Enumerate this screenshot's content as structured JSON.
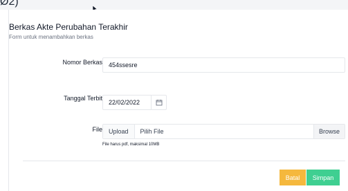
{
  "header": {
    "partial_text": "Ø2)"
  },
  "card": {
    "title": "Berkas Akte Perubahan Terakhir",
    "subtitle": "Form untuk menambahkan berkas"
  },
  "form": {
    "nomor_berkas": {
      "label": "Nomor Berkas",
      "value": "454ssesre"
    },
    "tanggal_terbit": {
      "label": "Tanggal Terbit",
      "value": "22/02/2022",
      "icon": "calendar-icon"
    },
    "file": {
      "label": "File",
      "upload_label": "Upload",
      "placeholder": "Pilih File",
      "browse_label": "Browse",
      "help_text": "File harus pdf, maksimal 10MB"
    }
  },
  "actions": {
    "batal_label": "Batal",
    "simpan_label": "Simpan",
    "batal_color": "#f5b83d",
    "simpan_color": "#3fcf91"
  }
}
